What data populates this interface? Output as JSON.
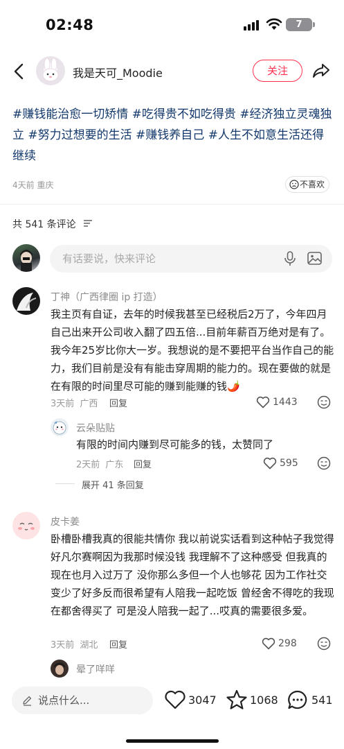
{
  "status_bar": {
    "time": "02:48",
    "battery": "7"
  },
  "nav": {
    "author_name": "我是天可_Moodie",
    "follow_label": "关注"
  },
  "post": {
    "tags": "#赚钱能治愈一切矫情 #吃得贵不如吃得贵 #经济独立灵魂独立 #努力过想要的生活 #赚钱养自己 #人生不如意生活还得继续",
    "meta": "4天前 重庆",
    "dislike_label": "不喜欢"
  },
  "comments_header": {
    "count_label": "共 541 条评论",
    "input_placeholder": "有话要说，快来评论"
  },
  "comments": [
    {
      "author": "丁神（广西律圈 ip 打造）",
      "text": "我主页有自证，去年的时候我甚至已经税后2万了，今年四月自己出来开公司收入翻了四五倍...目前年薪百万绝对是有了。我今年25岁比你大一岁。我想说的是不要把平台当作自己的能力，我们目前是没有有能击穿周期的能力的。现在要做的就是在有限的时间里尽可能的赚到能赚的钱🌶️",
      "time": "3天前",
      "location": "广西",
      "reply_label": "回复",
      "likes": "1443",
      "replies": [
        {
          "author": "云朵贴贴",
          "text": "有限的时间内赚到尽可能多的钱，太赞同了",
          "time": "2天前",
          "location": "广东",
          "reply_label": "回复",
          "likes": "595"
        }
      ],
      "expand_label": "展开 41 条回复"
    },
    {
      "author": "皮卡姜",
      "text": "卧槽卧槽我真的很能共情你 我以前说实话看到这种帖子我觉得好凡尔赛啊因为我那时候没钱 我理解不了这种感受 但我真的现在也月入过万了 没你那么多但一个人也够花 因为工作社交变少了好多反而很希望有人陪我一起吃饭 曾经舍不得吃的我现在都舍得买了 可是没人陪我一起了...哎真的需要很多爱。",
      "time": "3天前",
      "location": "湖北",
      "reply_label": "回复",
      "likes": "298"
    },
    {
      "author": "晕了咩咩"
    }
  ],
  "bottom_bar": {
    "say_placeholder": "说点什么...",
    "likes": "3047",
    "stars": "1068",
    "comments": "541"
  }
}
